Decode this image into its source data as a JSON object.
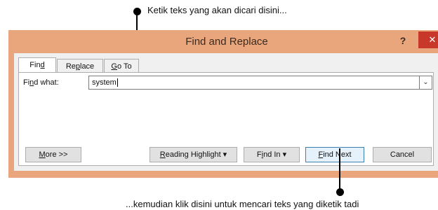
{
  "annotations": {
    "top": "Ketik teks yang akan dicari disini...",
    "bottom": "...kemudian klik disini untuk mencari teks yang diketik tadi"
  },
  "window": {
    "title": "Find and Replace",
    "help_glyph": "?",
    "close_glyph": "✕"
  },
  "tabs": [
    {
      "pre": "Fin",
      "u": "d",
      "post": ""
    },
    {
      "pre": "Re",
      "u": "p",
      "post": "lace"
    },
    {
      "pre": "",
      "u": "G",
      "post": "o To"
    }
  ],
  "find": {
    "label_pre": "Fi",
    "label_u": "n",
    "label_post": "d what:",
    "value": "system",
    "dropdown_glyph": "⌄"
  },
  "buttons": {
    "more": {
      "pre": "",
      "u": "M",
      "post": "ore >>"
    },
    "reading_highlight": {
      "pre": "",
      "u": "R",
      "post": "eading Highlight ▾"
    },
    "find_in": {
      "pre": "F",
      "u": "i",
      "post": "nd In ▾"
    },
    "find_next": {
      "pre": "",
      "u": "F",
      "post": "ind Next"
    },
    "cancel": {
      "pre": "",
      "u": "",
      "post": "Cancel"
    }
  },
  "colors": {
    "title_bar": "#e9a67c",
    "close_button": "#c7382b",
    "dialog_body": "#f0f0f0"
  }
}
